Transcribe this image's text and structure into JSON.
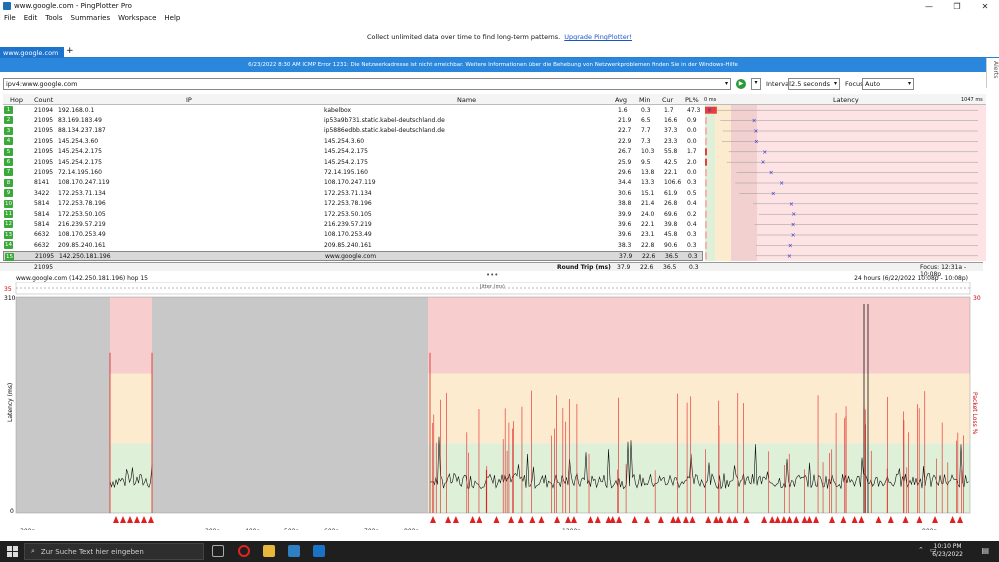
{
  "window": {
    "title": "www.google.com - PingPlotter Pro",
    "minimize": "—",
    "maximize": "❐",
    "close": "✕"
  },
  "menu": [
    "File",
    "Edit",
    "Tools",
    "Summaries",
    "Workspace",
    "Help"
  ],
  "promo": {
    "text": "Collect unlimited data over time to find long-term patterns.",
    "link": "Upgrade PingPlotter!"
  },
  "tab": {
    "label": "www.google.com",
    "check": "✓",
    "add": "+"
  },
  "error": "6/23/2022 8:30 AM ICMP Error 1231: Die Netzwerkadresse ist nicht erreichbar. Weitere Informationen über die Behebung von Netzwerkproblemen finden Sie in der Windows-Hilfe",
  "alerts_label": "Alerts",
  "toolbar": {
    "target": "ipv4:www.google.com",
    "interval_label": "Interval",
    "interval": "2.5 seconds",
    "focus_label": "Focus",
    "focus": "Auto",
    "scale_100": "100ms",
    "scale_200": "200ms"
  },
  "columns": {
    "hop": "Hop",
    "count": "Count",
    "ip": "IP",
    "name": "Name",
    "avg": "Avg",
    "min": "Min",
    "cur": "Cur",
    "pl": "PL%",
    "lat_min": "0 ms",
    "latency": "Latency",
    "lat_max": "1047 ms"
  },
  "hops": [
    {
      "hop": "1",
      "count": "21094",
      "ip": "192.168.0.1",
      "name": "kabelbox",
      "avg": "1.6",
      "min": "0.3",
      "cur": "1.7",
      "pl": "47.3"
    },
    {
      "hop": "2",
      "count": "21095",
      "ip": "83.169.183.49",
      "name": "ip53a9b731.static.kabel-deutschland.de",
      "avg": "21.9",
      "min": "6.5",
      "cur": "16.6",
      "pl": "0.9"
    },
    {
      "hop": "3",
      "count": "21095",
      "ip": "88.134.237.187",
      "name": "ip5886edbb.static.kabel-deutschland.de",
      "avg": "22.7",
      "min": "7.7",
      "cur": "37.3",
      "pl": "0.0"
    },
    {
      "hop": "4",
      "count": "21095",
      "ip": "145.254.3.60",
      "name": "145.254.3.60",
      "avg": "22.9",
      "min": "7.3",
      "cur": "23.3",
      "pl": "0.0"
    },
    {
      "hop": "5",
      "count": "21095",
      "ip": "145.254.2.175",
      "name": "145.254.2.175",
      "avg": "26.7",
      "min": "10.3",
      "cur": "55.8",
      "pl": "1.7"
    },
    {
      "hop": "6",
      "count": "21095",
      "ip": "145.254.2.175",
      "name": "145.254.2.175",
      "avg": "25.9",
      "min": "9.5",
      "cur": "42.5",
      "pl": "2.0"
    },
    {
      "hop": "7",
      "count": "21095",
      "ip": "72.14.195.160",
      "name": "72.14.195.160",
      "avg": "29.6",
      "min": "13.8",
      "cur": "22.1",
      "pl": "0.0"
    },
    {
      "hop": "8",
      "count": "8141",
      "ip": "108.170.247.119",
      "name": "108.170.247.119",
      "avg": "34.4",
      "min": "13.3",
      "cur": "106.6",
      "pl": "0.3"
    },
    {
      "hop": "9",
      "count": "3422",
      "ip": "172.253.71.134",
      "name": "172.253.71.134",
      "avg": "30.6",
      "min": "15.1",
      "cur": "61.9",
      "pl": "0.5"
    },
    {
      "hop": "10",
      "count": "5814",
      "ip": "172.253.78.196",
      "name": "172.253.78.196",
      "avg": "38.8",
      "min": "21.4",
      "cur": "26.8",
      "pl": "0.4"
    },
    {
      "hop": "11",
      "count": "5814",
      "ip": "172.253.50.105",
      "name": "172.253.50.105",
      "avg": "39.9",
      "min": "24.0",
      "cur": "69.6",
      "pl": "0.2"
    },
    {
      "hop": "12",
      "count": "5814",
      "ip": "216.239.57.219",
      "name": "216.239.57.219",
      "avg": "39.6",
      "min": "22.1",
      "cur": "39.8",
      "pl": "0.4"
    },
    {
      "hop": "13",
      "count": "6632",
      "ip": "108.170.253.49",
      "name": "108.170.253.49",
      "avg": "39.6",
      "min": "23.1",
      "cur": "45.8",
      "pl": "0.3"
    },
    {
      "hop": "14",
      "count": "6632",
      "ip": "209.85.240.161",
      "name": "209.85.240.161",
      "avg": "38.3",
      "min": "22.8",
      "cur": "90.6",
      "pl": "0.3"
    },
    {
      "hop": "15",
      "count": "21095",
      "ip": "142.250.181.196",
      "name": "www.google.com",
      "avg": "37.9",
      "min": "22.6",
      "cur": "36.5",
      "pl": "0.3"
    }
  ],
  "summary": {
    "count": "21095",
    "label": "Round Trip (ms)",
    "avg": "37.9",
    "min": "22.6",
    "cur": "36.5",
    "pl": "0.3",
    "focus": "Focus: 12:31a - 10:08p"
  },
  "graph": {
    "title": "www.google.com (142.250.181.196) hop 15",
    "range": "24 hours (6/22/2022 10:08p - 10:08p)",
    "jitter_label": "Jitter (ms)",
    "jitter_max": "35",
    "ymax_left": "310",
    "ymax_right": "30",
    "y_zero": "0",
    "ylabel_left": "Latency (ms)",
    "ylabel_right": "Packet Loss %",
    "xticks": [
      "300p",
      "300a",
      "400a",
      "500a",
      "600a",
      "700a",
      "800a",
      "1200p",
      "900p"
    ]
  },
  "taskbar": {
    "search": "Zur Suche Text hier eingeben",
    "time": "10:10 PM",
    "date": "6/23/2022"
  },
  "colors": {
    "accent": "#1e73cc",
    "good": "#dff0d8",
    "warn": "#fdebcf",
    "bad": "#f7cdcd",
    "loss": "#e02020"
  }
}
